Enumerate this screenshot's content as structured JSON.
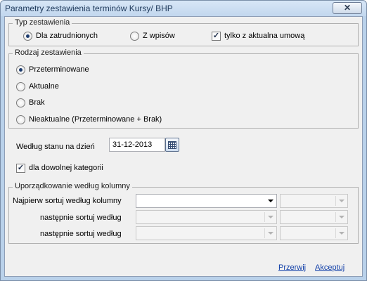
{
  "window": {
    "title": "Parametry zestawienia terminów Kursy/ BHP",
    "close_symbol": "✕"
  },
  "typ_group": {
    "title": "Typ zestawienia",
    "options": [
      {
        "label": "Dla zatrudnionych",
        "selected": true
      },
      {
        "label": "Z wpisów",
        "selected": false
      }
    ],
    "checkbox": {
      "label": "tylko z aktualna umową",
      "checked": true
    }
  },
  "rodzaj_group": {
    "title": "Rodzaj zestawienia",
    "options": [
      {
        "label": "Przeterminowane",
        "selected": true
      },
      {
        "label": "Aktualne",
        "selected": false
      },
      {
        "label": "Brak",
        "selected": false
      },
      {
        "label": "Nieaktualne (Przeterminowane + Brak)",
        "selected": false
      }
    ]
  },
  "date": {
    "label": "Według stanu na dzień",
    "value": "31-12-2013"
  },
  "category_checkbox": {
    "label": "dla dowolnej kategorii",
    "checked": true
  },
  "sort_group": {
    "title": "Uporządkowanie według kolumny",
    "rows": [
      {
        "label": "Najpierw sortuj według kolumny"
      },
      {
        "label": "następnie sortuj według"
      },
      {
        "label": "następnie sortuj według"
      }
    ]
  },
  "buttons": {
    "cancel": "Przerwij",
    "accept": "Akceptuj"
  },
  "colors": {
    "link": "#0f3ea8",
    "frame": "#b9d1ea",
    "client": "#f0f0f0"
  }
}
